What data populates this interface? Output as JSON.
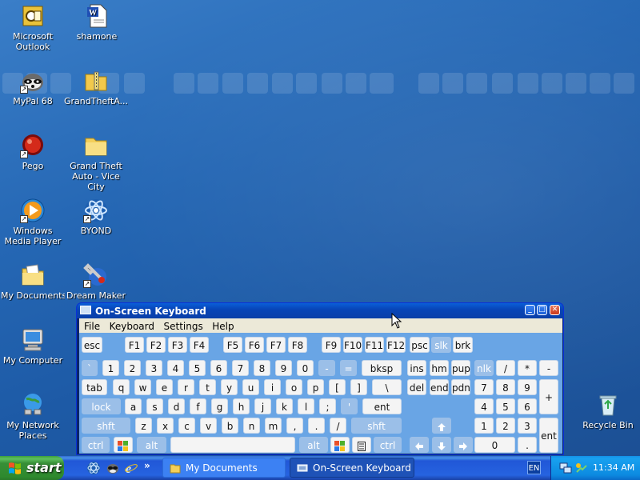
{
  "desktop": {
    "icons": [
      {
        "label": "Microsoft Outlook",
        "icon": "outlook-icon"
      },
      {
        "label": "shamone",
        "icon": "word-document-icon"
      },
      {
        "label": "MyPal 68",
        "icon": "mypal-icon"
      },
      {
        "label": "GrandTheftA...",
        "icon": "zip-folder-icon"
      },
      {
        "label": "Pego",
        "icon": "pego-icon"
      },
      {
        "label": "Grand Theft Auto - Vice City",
        "icon": "folder-icon"
      },
      {
        "label": "Windows Media Player",
        "icon": "media-player-icon"
      },
      {
        "label": "BYOND",
        "icon": "byond-icon"
      },
      {
        "label": "My Documents",
        "icon": "my-documents-icon"
      },
      {
        "label": "Dream Maker",
        "icon": "dream-maker-icon"
      },
      {
        "label": "My Computer",
        "icon": "my-computer-icon"
      },
      {
        "label": "My Network Places",
        "icon": "network-places-icon"
      },
      {
        "label": "Recycle Bin",
        "icon": "recycle-bin-icon"
      }
    ]
  },
  "osk": {
    "title": "On-Screen Keyboard",
    "menu": [
      "File",
      "Keyboard",
      "Settings",
      "Help"
    ],
    "keys": {
      "row1": [
        "esc",
        "F1",
        "F2",
        "F3",
        "F4",
        "F5",
        "F6",
        "F7",
        "F8",
        "F9",
        "F10",
        "F11",
        "F12",
        "psc",
        "slk",
        "brk"
      ],
      "row2": [
        "`",
        "1",
        "2",
        "3",
        "4",
        "5",
        "6",
        "7",
        "8",
        "9",
        "0",
        "-",
        "=",
        "bksp",
        "ins",
        "hm",
        "pup",
        "nlk",
        "/",
        "*",
        "-"
      ],
      "row3": [
        "tab",
        "q",
        "w",
        "e",
        "r",
        "t",
        "y",
        "u",
        "i",
        "o",
        "p",
        "[",
        "]",
        "\\",
        "del",
        "end",
        "pdn",
        "7",
        "8",
        "9",
        "+"
      ],
      "row4": [
        "lock",
        "a",
        "s",
        "d",
        "f",
        "g",
        "h",
        "j",
        "k",
        "l",
        ";",
        "'",
        "ent",
        "4",
        "5",
        "6"
      ],
      "row5": [
        "shft",
        "z",
        "x",
        "c",
        "v",
        "b",
        "n",
        "m",
        ",",
        ".",
        "/",
        "shft",
        "1",
        "2",
        "3",
        "ent"
      ],
      "row6": [
        "ctrl",
        "alt",
        "alt",
        "ctrl",
        "0",
        "."
      ]
    }
  },
  "taskbar": {
    "start_label": "start",
    "quick_launch": [
      "byond-icon",
      "mypal-icon",
      "internet-explorer-icon"
    ],
    "more_label": "»",
    "tasks": [
      {
        "label": "My Documents",
        "active": false
      },
      {
        "label": "On-Screen Keyboard",
        "active": true
      }
    ],
    "language": "EN",
    "clock": "11:34 AM"
  },
  "colors": {
    "desktop_blue": "#2567b4",
    "taskbar_blue": "#2157d7",
    "start_green": "#378f37",
    "osk_keys_bg": "#69a5e5"
  }
}
